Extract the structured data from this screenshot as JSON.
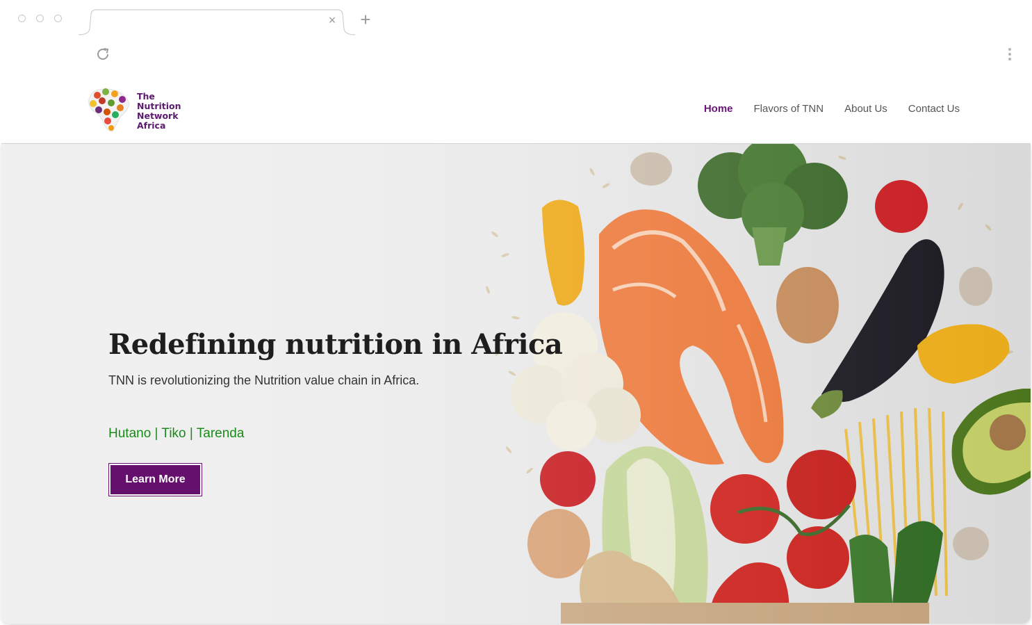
{
  "browser": {
    "tab_title": "",
    "close_glyph": "×",
    "new_tab_glyph": "+",
    "icons": [
      "reload-icon",
      "kebab-menu-icon",
      "tab-close-icon",
      "new-tab-icon"
    ]
  },
  "site": {
    "logo_lines": [
      "The",
      "Nutrition",
      "Network",
      "Africa"
    ],
    "nav": [
      {
        "label": "Home",
        "active": true
      },
      {
        "label": "Flavors of TNN",
        "active": false
      },
      {
        "label": "About Us",
        "active": false
      },
      {
        "label": "Contact Us",
        "active": false
      }
    ]
  },
  "hero": {
    "title": "Redefining nutrition in Africa",
    "subtitle": "TNN is revolutionizing the Nutrition value chain in Africa.",
    "brands": "Hutano | Tiko | Tarenda",
    "cta_label": "Learn More",
    "image": "food-flatlay-photo"
  },
  "colors": {
    "brand_purple": "#66106e",
    "nav_active": "#6a1678",
    "brand_green": "#1a8a1a"
  }
}
